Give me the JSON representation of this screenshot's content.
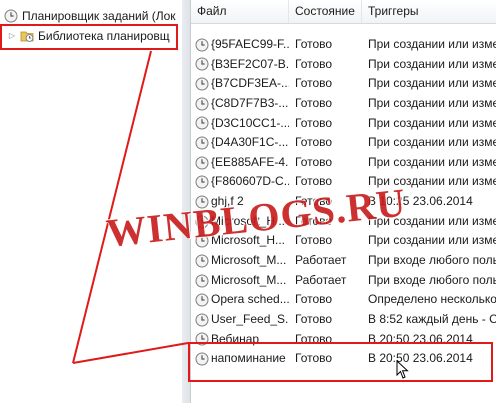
{
  "tree": {
    "root_label": "Планировщик заданий (Лок",
    "library_label": "Библиотека планировщ"
  },
  "columns": {
    "file": "Файл",
    "state": "Состояние",
    "triggers": "Триггеры"
  },
  "rows": [
    {
      "name": "{95FAEC99-F...",
      "state": "Готово",
      "trigger": "При создании или измен"
    },
    {
      "name": "{B3EF2C07-B...",
      "state": "Готово",
      "trigger": "При создании или измен"
    },
    {
      "name": "{B7CDF3EA-...",
      "state": "Готово",
      "trigger": "При создании или измен"
    },
    {
      "name": "{C8D7F7B3-...",
      "state": "Готово",
      "trigger": "При создании или измен"
    },
    {
      "name": "{D3C10CC1-...",
      "state": "Готово",
      "trigger": "При создании или измен"
    },
    {
      "name": "{D4A30F1C-...",
      "state": "Готово",
      "trigger": "При создании или измен"
    },
    {
      "name": "{EE885AFE-4...",
      "state": "Готово",
      "trigger": "При создании или измен"
    },
    {
      "name": "{F860607D-C...",
      "state": "Готово",
      "trigger": "При создании или измен"
    },
    {
      "name": "ghj,f 2",
      "state": "Готово",
      "trigger": "В 10:25 23.06.2014"
    },
    {
      "name": "Microsoft_H...",
      "state": "Готово",
      "trigger": "При создании или измен"
    },
    {
      "name": "Microsoft_H...",
      "state": "Готово",
      "trigger": "При создании или измен"
    },
    {
      "name": "Microsoft_M...",
      "state": "Работает",
      "trigger": "При входе любого поль"
    },
    {
      "name": "Microsoft_M...",
      "state": "Работает",
      "trigger": "При входе любого поль"
    },
    {
      "name": "Opera sched...",
      "state": "Готово",
      "trigger": "Определено несколько"
    },
    {
      "name": "User_Feed_S...",
      "state": "Готово",
      "trigger": "В 8:52 каждый день - Ср"
    },
    {
      "name": "Вебинар",
      "state": "Готово",
      "trigger": "В 20:50 23.06.2014"
    },
    {
      "name": "напоминание",
      "state": "Готово",
      "trigger": "В 20:50 23.06.2014"
    }
  ],
  "watermark": "WINBLOGS.RU",
  "colors": {
    "annotation_red": "#e01919",
    "watermark_red": "#c81a1a"
  }
}
